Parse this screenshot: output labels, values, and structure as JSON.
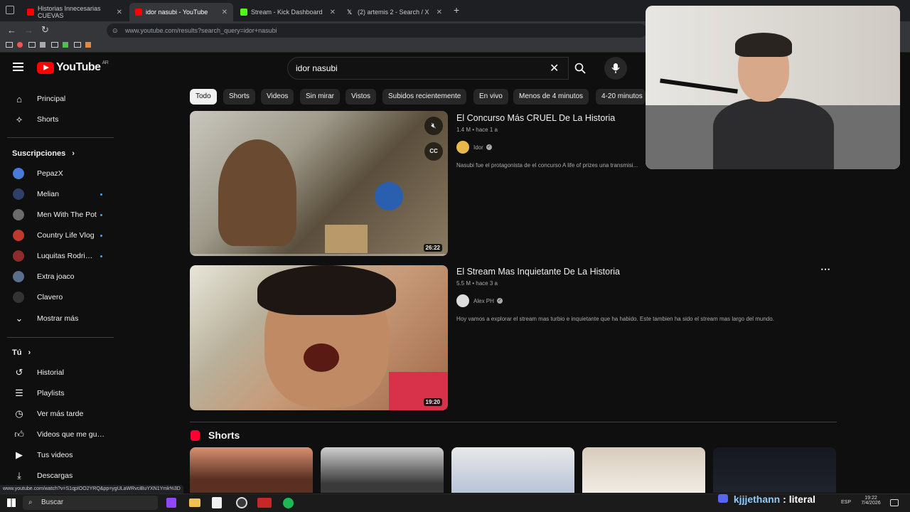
{
  "browser": {
    "tabs": [
      {
        "title": "Historias Innecesarias CUEVAS"
      },
      {
        "title": "idor nasubi - YouTube"
      },
      {
        "title": "Stream - Kick Dashboard"
      },
      {
        "title": "(2) artemis 2 - Search / X"
      }
    ],
    "url": "www.youtube.com/results?search_query=idor+nasubi",
    "status_url": "www.youtube.com/watch?v=S1qpIOO2YRQ&pp=ygULaWRvciBuYXN1Ymk%3D"
  },
  "header": {
    "logo_text": "YouTube",
    "logo_region": "AR",
    "search_value": "idor nasubi"
  },
  "sidebar": {
    "main": [
      {
        "label": "Principal",
        "icon": "home-icon"
      },
      {
        "label": "Shorts",
        "icon": "shorts-icon"
      }
    ],
    "subs_heading": "Suscripciones",
    "subs": [
      {
        "label": "PepazX",
        "dot": false,
        "color": "#4a7bd8"
      },
      {
        "label": "Melian",
        "dot": true,
        "color": "#2e3f6a"
      },
      {
        "label": "Men With The Pot",
        "dot": true,
        "color": "#6b6b6b"
      },
      {
        "label": "Country Life Vlog",
        "dot": true,
        "color": "#c0392b"
      },
      {
        "label": "Luquitas Rodriguez",
        "dot": true,
        "color": "#8e2c2c"
      },
      {
        "label": "Extra joaco",
        "dot": false,
        "color": "#5a6f8a"
      },
      {
        "label": "Clavero",
        "dot": false,
        "color": "#333333"
      }
    ],
    "more": "Mostrar más",
    "you_heading": "Tú",
    "you": [
      {
        "label": "Historial",
        "icon": "history-icon"
      },
      {
        "label": "Playlists",
        "icon": "playlists-icon"
      },
      {
        "label": "Ver más tarde",
        "icon": "watch-later-icon"
      },
      {
        "label": "Videos que me gustaron",
        "icon": "like-icon"
      },
      {
        "label": "Tus videos",
        "icon": "your-videos-icon"
      },
      {
        "label": "Descargas",
        "icon": "download-icon"
      }
    ]
  },
  "chips": [
    "Todo",
    "Shorts",
    "Videos",
    "Sin mirar",
    "Vistos",
    "Subidos recientemente",
    "En vivo",
    "Menos de 4 minutos",
    "4-20 minutos"
  ],
  "results": [
    {
      "title": "El Concurso Más CRUEL De La Historia",
      "meta": "1.4 M • hace 1 a",
      "channel": "Idor",
      "description": "Nasubi fue el protagonista de el concurso A life of prizes una transmisi...",
      "duration": "26:22"
    },
    {
      "title": "El Stream Mas Inquietante De La Historia",
      "meta": "5.5 M • hace 3 a",
      "channel": "Alex PH",
      "description": "Hoy vamos a explorar el stream mas turbio e inquietante que ha habido. Este tambien ha sido el stream mas largo del mundo.",
      "duration": "19:20"
    }
  ],
  "shorts_heading": "Shorts",
  "taskbar": {
    "search": "Buscar",
    "lang": "ESP",
    "time": "19:22",
    "date": "7/4/2026"
  },
  "overlay": {
    "username": "kjjjethann",
    "suffix": ": literal"
  }
}
